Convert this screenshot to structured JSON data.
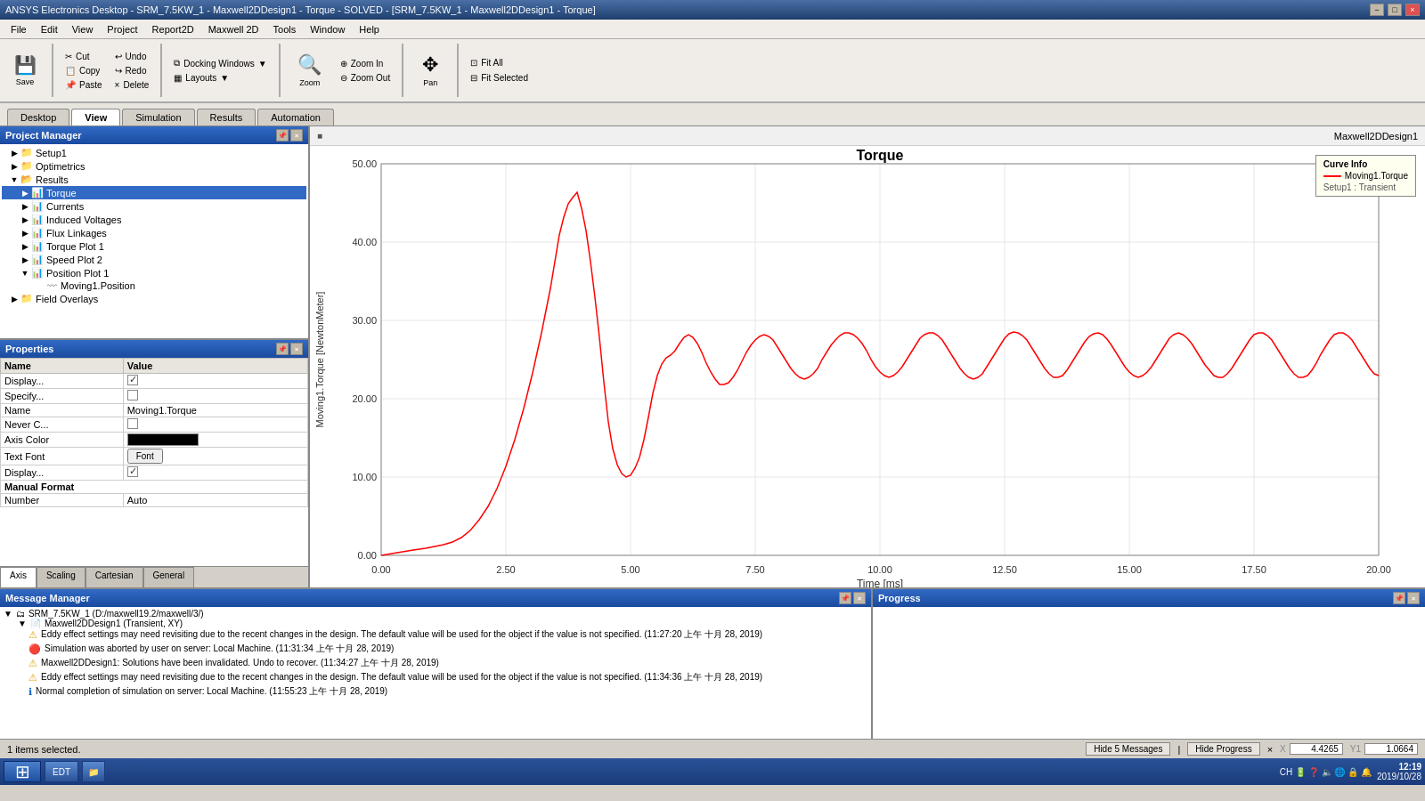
{
  "titlebar": {
    "text": "ANSYS Electronics Desktop - SRM_7.5KW_1 - Maxwell2DDesign1 - Torque - SOLVED - [SRM_7.5KW_1 - Maxwell2DDesign1 - Torque]",
    "controls": [
      "−",
      "□",
      "×"
    ]
  },
  "menubar": {
    "items": [
      "File",
      "Edit",
      "View",
      "Project",
      "Report2D",
      "Maxwell 2D",
      "Tools",
      "Window",
      "Help"
    ]
  },
  "toolbar": {
    "save_label": "Save",
    "cut_label": "Cut",
    "copy_label": "Copy",
    "undo_label": "Undo",
    "redo_label": "Redo",
    "paste_label": "Paste",
    "delete_label": "Delete",
    "docking_label": "Docking Windows",
    "layouts_label": "Layouts",
    "zoom_label": "Zoom",
    "zoom_in_label": "Zoom In",
    "zoom_out_label": "Zoom Out",
    "pan_label": "Pan",
    "fit_all_label": "Fit All",
    "fit_selected_label": "Fit Selected"
  },
  "navtabs": {
    "items": [
      "Desktop",
      "View",
      "Simulation",
      "Results",
      "Automation"
    ],
    "active": "View"
  },
  "project_manager": {
    "title": "Project Manager",
    "tree": [
      {
        "id": "setup1",
        "label": "Setup1",
        "level": 1,
        "icon": "folder",
        "toggle": "▶"
      },
      {
        "id": "optimetrics",
        "label": "Optimetrics",
        "level": 1,
        "icon": "folder",
        "toggle": "▶"
      },
      {
        "id": "results",
        "label": "Results",
        "level": 1,
        "icon": "folder",
        "toggle": "▼"
      },
      {
        "id": "torque",
        "label": "Torque",
        "level": 2,
        "icon": "plot",
        "toggle": "▶",
        "selected": true
      },
      {
        "id": "currents",
        "label": "Currents",
        "level": 2,
        "icon": "plot",
        "toggle": "▶"
      },
      {
        "id": "induced-voltages",
        "label": "Induced Voltages",
        "level": 2,
        "icon": "plot",
        "toggle": "▶"
      },
      {
        "id": "flux-linkages",
        "label": "Flux Linkages",
        "level": 2,
        "icon": "plot",
        "toggle": "▶"
      },
      {
        "id": "torque-plot-1",
        "label": "Torque Plot 1",
        "level": 2,
        "icon": "plot",
        "toggle": "▶"
      },
      {
        "id": "speed-plot-2",
        "label": "Speed Plot 2",
        "level": 2,
        "icon": "plot",
        "toggle": "▶"
      },
      {
        "id": "position-plot-1",
        "label": "Position Plot 1",
        "level": 2,
        "icon": "plot",
        "toggle": "▼"
      },
      {
        "id": "moving1-position",
        "label": "Moving1.Position",
        "level": 3,
        "icon": "item"
      },
      {
        "id": "field-overlays",
        "label": "Field Overlays",
        "level": 1,
        "icon": "folder",
        "toggle": "▶"
      }
    ]
  },
  "properties": {
    "title": "Properties",
    "columns": [
      "Name",
      "Value"
    ],
    "rows": [
      {
        "name": "Display...",
        "value": "☑",
        "type": "checkbox"
      },
      {
        "name": "Specify...",
        "value": "☐",
        "type": "checkbox"
      },
      {
        "name": "Name",
        "value": "Moving1.Torque"
      },
      {
        "name": "Never C...",
        "value": "☐",
        "type": "checkbox"
      },
      {
        "name": "Axis Color",
        "value": "■ black",
        "type": "color"
      },
      {
        "name": "Text Font",
        "value": "Font",
        "type": "button"
      },
      {
        "name": "Display...",
        "value": "☑",
        "type": "checkbox"
      },
      {
        "name": "Manual Format",
        "value": "",
        "type": "bold"
      },
      {
        "name": "Number",
        "value": "Auto",
        "type": "text"
      }
    ],
    "tabs": [
      "Axis",
      "Scaling",
      "Cartesian",
      "General"
    ]
  },
  "chart": {
    "title": "Torque",
    "design_label": "Maxwell2DDesign1",
    "x_label": "Time [ms]",
    "y_label": "Moving1.Torque [NewtonMeter]",
    "x_min": 0.0,
    "x_max": 20.0,
    "y_min": 0.0,
    "y_max": 50.0,
    "x_ticks": [
      "0.00",
      "2.50",
      "5.00",
      "7.50",
      "10.00",
      "12.50",
      "15.00",
      "17.50",
      "20.00"
    ],
    "y_ticks": [
      "0.00",
      "10.00",
      "20.00",
      "30.00",
      "40.00",
      "50.00"
    ],
    "curve_info_title": "Curve Info",
    "curve_name": "Moving1.Torque",
    "curve_setup": "Setup1 : Transient"
  },
  "message_manager": {
    "title": "Message Manager",
    "tree_root": "SRM_7.5KW_1 (D:/maxwell19.2/maxwell/3/)",
    "tree_sub": "Maxwell2DDesign1 (Transient, XY)",
    "messages": [
      {
        "type": "warn",
        "text": "Eddy effect settings may need revisiting due to the recent changes in the design.  The default value will be used for the object if the value is not specified.  (11:27:20 上午  十月 28, 2019)"
      },
      {
        "type": "error",
        "text": "Simulation was aborted by user on server: Local Machine. (11:31:34 上午  十月 28, 2019)"
      },
      {
        "type": "warn",
        "text": "Maxwell2DDesign1: Solutions have been invalidated. Undo to recover. (11:34:27 上午  十月 28, 2019)"
      },
      {
        "type": "warn",
        "text": "Eddy effect settings may need revisiting due to the recent changes in the design.  The default value will be used for the object if the value is not specified.  (11:34:36 上午  十月 28, 2019)"
      },
      {
        "type": "info",
        "text": "Normal completion of simulation on server: Local Machine. (11:55:23 上午  十月 28, 2019)"
      }
    ]
  },
  "progress": {
    "title": "Progress"
  },
  "statusbar": {
    "left_text": "1 items selected.",
    "hide_messages_btn": "Hide 5 Messages",
    "hide_progress_btn": "Hide Progress",
    "x_label": "X",
    "x_value": "4.4265",
    "y_label": "Y1",
    "y_value": "1.0664"
  },
  "taskbar": {
    "start_icon": "⊞",
    "apps": [
      "EDT"
    ],
    "time": "12:19",
    "date": "2019/10/28"
  }
}
